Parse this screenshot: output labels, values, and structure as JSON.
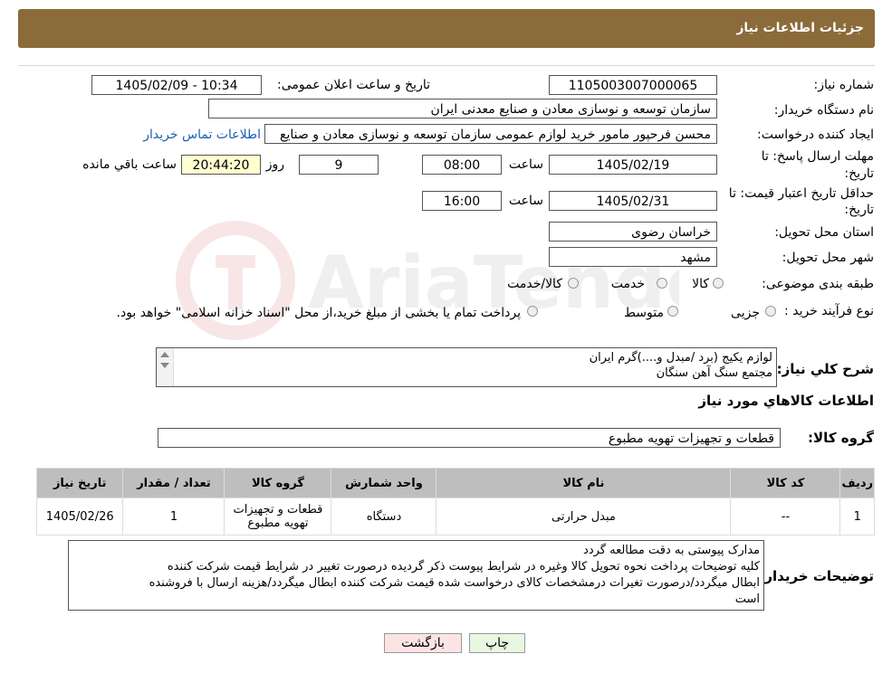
{
  "header": {
    "title": "جزئیات اطلاعات نیاز"
  },
  "fields": {
    "need_number_label": "شماره نیاز:",
    "need_number": "1105003007000065",
    "announce_label": "تاریخ و ساعت اعلان عمومی:",
    "announce_value": "1405/02/09 - 10:34",
    "buyer_org_label": "نام دستگاه خریدار:",
    "buyer_org": "سازمان توسعه و نوسازی معادن و صنایع معدنی ایران",
    "creator_label": "ایجاد کننده درخواست:",
    "creator": "محسن فرحپور مامور خرید لوازم عمومی سازمان توسعه و نوسازی معادن و صنایع",
    "contact_link": "اطلاعات تماس خریدار",
    "deadline_label_1": "مهلت ارسال پاسخ: تا",
    "deadline_label_2": "تاریخ:",
    "deadline_date": "1405/02/19",
    "time_label": "ساعت",
    "deadline_time": "08:00",
    "days_value": "9",
    "days_label": "روز و",
    "remaining_time": "20:44:20",
    "remaining_label": "ساعت باقي مانده",
    "validity_label_1": "حداقل تاريخ اعتبار قيمت: تا",
    "validity_label_2": "تاريخ:",
    "validity_date": "1405/02/31",
    "validity_time": "16:00",
    "province_label": "استان محل تحویل:",
    "province": "خراسان رضوی",
    "city_label": "شهر محل تحویل:",
    "city": "مشهد",
    "category_label": "طبقه بندی موضوعی:",
    "category_options": [
      "کالا",
      "خدمت",
      "کالا/خدمت"
    ],
    "process_label": "نوع فرآیند خرید :",
    "process_options": [
      "جزیی",
      "متوسط"
    ],
    "process_note": "پرداخت تمام یا بخشی از مبلغ خرید،از محل \"اسناد خزانه اسلامی\" خواهد بود."
  },
  "description": {
    "label": "شرح کلي نياز:",
    "line1": "لوازم یکیج (برد /مبدل و....)گرم ایران",
    "line2": "مجتمع سنگ آهن سنگان"
  },
  "goods_section_title": "اطلاعات کالاهاي مورد نياز",
  "goods_group": {
    "label": "گروه کالا:",
    "value": "قطعات و تجهیزات تهویه مطبوع"
  },
  "table": {
    "headers": [
      "رديف",
      "کد کالا",
      "نام کالا",
      "واحد شمارش",
      "گروه کالا",
      "تعداد / مقدار",
      "تاريخ نياز"
    ],
    "rows": [
      {
        "row": "1",
        "code": "--",
        "name": "مبدل حرارتی",
        "unit": "دستگاه",
        "group": "قطعات و تجهیزات تهویه مطبوع",
        "qty": "1",
        "date": "1405/02/26"
      }
    ]
  },
  "buyer_notes": {
    "label": "توضیحات خریدار:",
    "line1": "مدارک پیوستی به دقت مطالعه گردد",
    "line2": "کلیه توضیحات پرداخت نحوه تحویل کالا وغیره در شرایط پیوست ذکر گردیده درصورت تغییر در شرایط  قیمت شرکت کننده",
    "line3": "ابطال میگردد/درصورت تغیرات درمشخصات کالای درخواست شده قیمت شرکت کننده ابطال میگردد/هزینه ارسال با فروشنده",
    "line4": "است"
  },
  "buttons": {
    "print": "چاپ",
    "back": "بازگشت"
  },
  "colors": {
    "header_bg": "#8c6b3a",
    "table_header_bg": "#bebebe",
    "print_bg": "#e8f7e0",
    "back_bg": "#fde4e4",
    "link": "#1a5fb4"
  }
}
